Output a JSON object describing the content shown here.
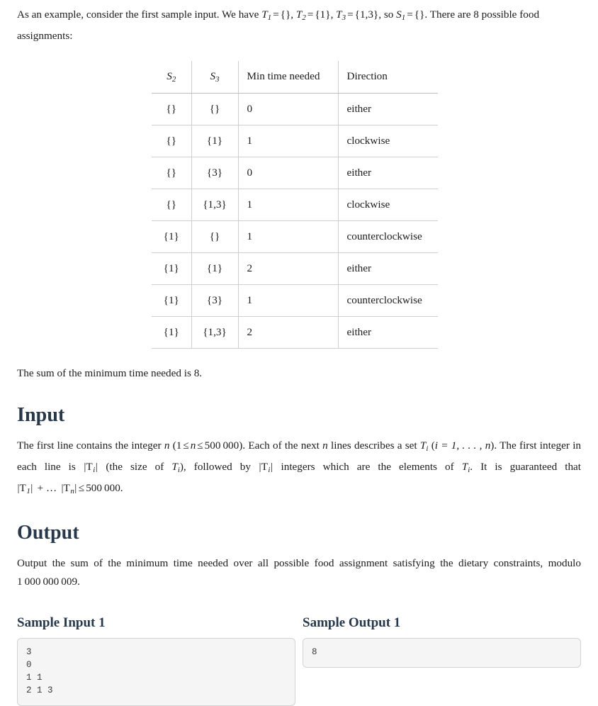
{
  "intro": {
    "lead": "As an example, consider the first sample input. We have ",
    "t1": "T",
    "t1sub": "1",
    "t1val": "{}",
    "t2": "T",
    "t2sub": "2",
    "t2val": "{1}",
    "t3": "T",
    "t3sub": "3",
    "t3val": "{1,3}",
    "so": ", so ",
    "s1": "S",
    "s1sub": "1",
    "s1val": "{}",
    "tail": ". There are 8 possible food assignments:",
    "comma": ", ",
    "equals": "=",
    "period": "."
  },
  "table": {
    "headers": [
      "S",
      "S",
      "Min time needed",
      "Direction"
    ],
    "header_subs": [
      "2",
      "3"
    ],
    "rows": [
      {
        "s2": "{}",
        "s3": "{}",
        "time": "0",
        "direction": "either"
      },
      {
        "s2": "{}",
        "s3": "{1}",
        "time": "1",
        "direction": "clockwise"
      },
      {
        "s2": "{}",
        "s3": "{3}",
        "time": "0",
        "direction": "either"
      },
      {
        "s2": "{}",
        "s3": "{1,3}",
        "time": "1",
        "direction": "clockwise"
      },
      {
        "s2": "{1}",
        "s3": "{}",
        "time": "1",
        "direction": "counterclockwise"
      },
      {
        "s2": "{1}",
        "s3": "{1}",
        "time": "2",
        "direction": "either"
      },
      {
        "s2": "{1}",
        "s3": "{3}",
        "time": "1",
        "direction": "counterclockwise"
      },
      {
        "s2": "{1}",
        "s3": "{1,3}",
        "time": "2",
        "direction": "either"
      }
    ]
  },
  "sum_line": "The sum of the minimum time needed is 8.",
  "input_section": {
    "heading": "Input",
    "p1": "The first line contains the integer ",
    "n": "n",
    "bound_open": "(1",
    "le": "≤",
    "bound_n": "n",
    "bound_max": "500 000",
    "bound_close": ").",
    "p2": " Each of the next ",
    "p3": " lines describes a set ",
    "T": "T",
    "Ti_sub": "i",
    "p4": " (",
    "i_eq": "i = 1, . . . , n",
    "p5": "). The first integer in each line is ",
    "absTi": "|T",
    "p6": " (the size of ",
    "p7": "), followed by ",
    "p8": " integers which are the elements of ",
    "p9": ". It is guaranteed that ",
    "absT1": "|T",
    "one": "1",
    "plus_dots": "+ … ",
    "absTn": "|T",
    "nsub": "n",
    "limit": "500 000",
    "end": "."
  },
  "output_section": {
    "heading": "Output",
    "text_a": "Output the sum of the minimum time needed over all possible food assignment satisfying the dietary constraints, modulo ",
    "modulus": "1 000 000 009",
    "text_b": "."
  },
  "samples": {
    "input": {
      "title": "Sample Input 1",
      "content": "3\n0\n1 1\n2 1 3"
    },
    "output": {
      "title": "Sample Output 1",
      "content": "8"
    }
  },
  "colors": {
    "heading": "#27384a",
    "body_text": "#1c1c1c",
    "table_border": "#cfcfcf",
    "sample_bg": "#f5f5f5",
    "sample_border": "#d3d3d3"
  }
}
